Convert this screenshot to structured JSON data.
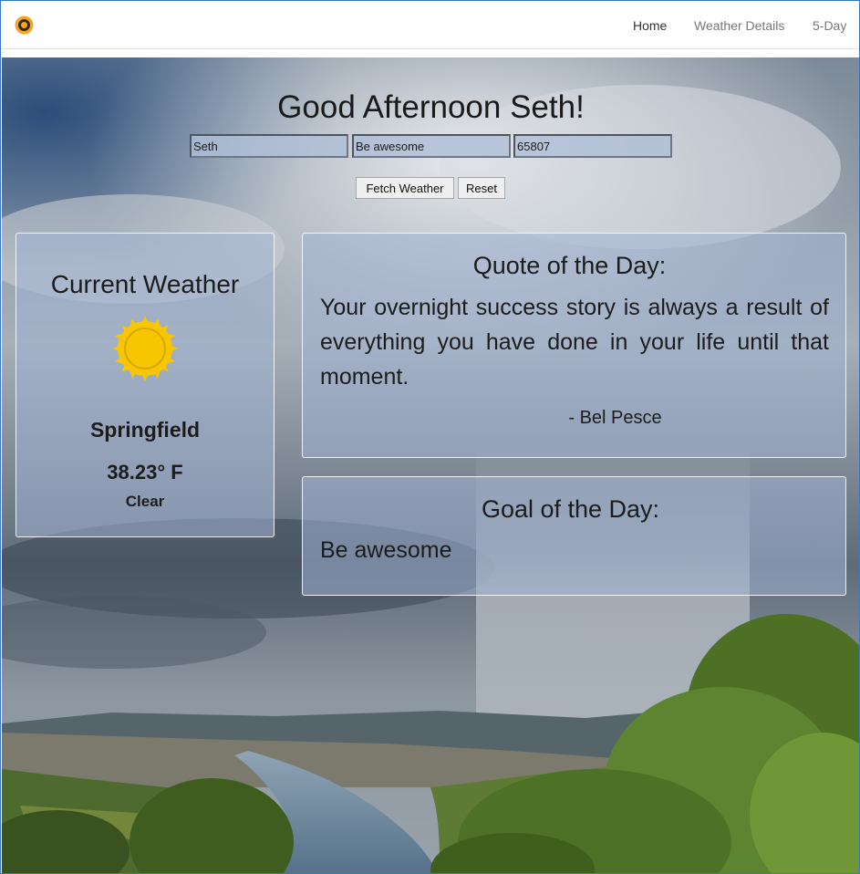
{
  "nav": {
    "items": [
      {
        "label": "Home"
      },
      {
        "label": "Weather Details"
      },
      {
        "label": "5-Day"
      }
    ]
  },
  "header": {
    "greeting": "Good Afternoon Seth!"
  },
  "form": {
    "name_value": "Seth",
    "goal_value": "Be awesome",
    "zip_value": "65807",
    "fetch_label": "Fetch Weather",
    "reset_label": "Reset"
  },
  "weather": {
    "title": "Current Weather",
    "icon": "sun-icon",
    "city": "Springfield",
    "temperature": "38.23° F",
    "condition": "Clear",
    "sun_color": "#f7c600"
  },
  "quote": {
    "title": "Quote of the Day:",
    "text": "Your overnight success story is always a result of everything you have done in your life until that moment.",
    "author": "- Bel Pesce"
  },
  "goal": {
    "title": "Goal of the Day:",
    "text": "Be awesome"
  },
  "colors": {
    "nav_active": "#333333",
    "nav_inactive": "#777777",
    "panel_bg": "rgba(160,178,212,0.55)"
  }
}
